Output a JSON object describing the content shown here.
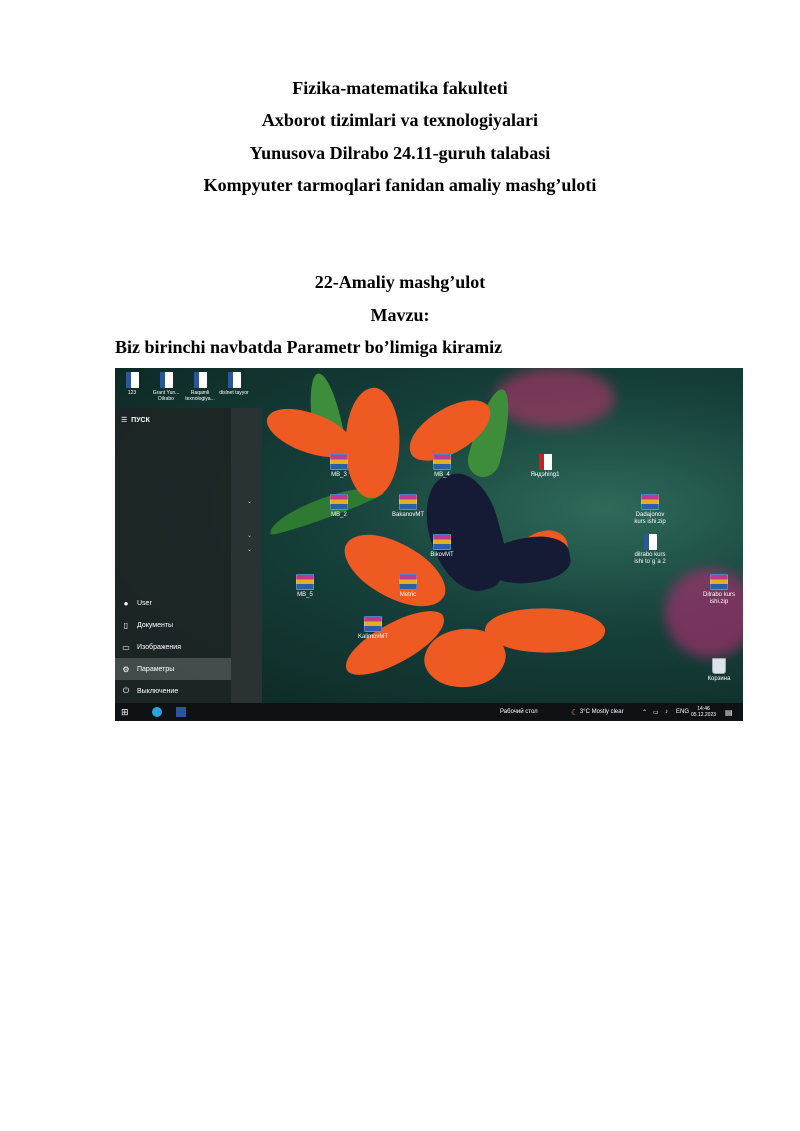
{
  "header": {
    "line1": "Fizika-matematika fakulteti",
    "line2": "Axborot tizimlari va texnologiyalari",
    "line3": "Yunusova Dilrabo 24.11-guruh talabasi",
    "line4": "Kompyuter tarmoqlari fanidan amaliy mashg’uloti"
  },
  "lesson": {
    "title": "22-Amaliy mashg’ulot",
    "topic": "Mavzu:",
    "intro": "Biz birinchi navbatda Parametr bo’limiga kiramiz"
  },
  "screenshot": {
    "top_icons": [
      {
        "label": "123",
        "icon": "word-doc-icon"
      },
      {
        "label": "Grant Yun... Dilrabo",
        "icon": "word-doc-icon"
      },
      {
        "label": "Raqamli texnologiya...",
        "icon": "word-doc-icon"
      },
      {
        "label": "dislnet tayyor",
        "icon": "word-doc-icon"
      }
    ],
    "desktop_icons": [
      {
        "label": "MB_3",
        "icon": "rar-icon"
      },
      {
        "label": "MB_4",
        "icon": "rar-icon"
      },
      {
        "label": "Яндэhing1",
        "icon": "pdf-icon"
      },
      {
        "label": "MB_2",
        "icon": "rar-icon"
      },
      {
        "label": "BakanovMT",
        "icon": "rar-icon"
      },
      {
        "label": "Dadajonov kurs ishi.zip",
        "icon": "rar-icon"
      },
      {
        "label": "BikovMT",
        "icon": "rar-icon"
      },
      {
        "label": "dilrabo kurs ishi to`g`a 2",
        "icon": "word-doc-icon"
      },
      {
        "label": "MB_5",
        "icon": "rar-icon"
      },
      {
        "label": "Metric",
        "icon": "rar-icon"
      },
      {
        "label": "Dilrabo kurs ishi.zip",
        "icon": "rar-icon"
      },
      {
        "label": "KalimovMT",
        "icon": "rar-icon"
      },
      {
        "label": "Корзина",
        "icon": "recycle-bin-icon"
      }
    ],
    "start_menu": {
      "title": "ПУСК",
      "items": [
        {
          "label": "User",
          "icon": "user-avatar-icon"
        },
        {
          "label": "Документы",
          "icon": "document-icon"
        },
        {
          "label": "Изображения",
          "icon": "pictures-icon"
        },
        {
          "label": "Параметры",
          "icon": "settings-gear-icon"
        },
        {
          "label": "Выключение",
          "icon": "power-icon"
        }
      ]
    },
    "taskbar": {
      "search_label": "Рабочий стол",
      "weather": "3°C  Mostly clear",
      "lang": "ENG",
      "time": "14:46",
      "date": "05.12.2023"
    }
  }
}
